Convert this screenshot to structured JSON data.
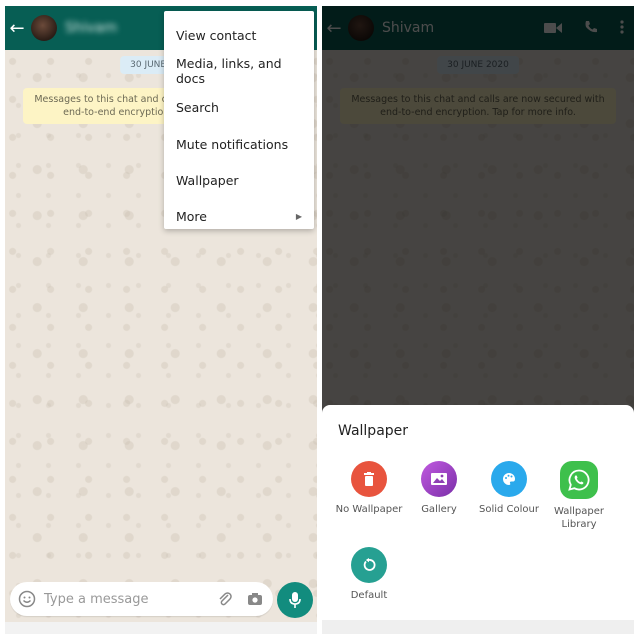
{
  "left": {
    "contact_name": "Shivam",
    "date_chip": "30 JUNE 2020",
    "secure_notice": "Messages to this chat and calls are now secured with end-to-end encryption. Tap for more info.",
    "menu": {
      "items": [
        {
          "label": "View contact"
        },
        {
          "label": "Media, links, and docs"
        },
        {
          "label": "Search"
        },
        {
          "label": "Mute notifications"
        },
        {
          "label": "Wallpaper"
        },
        {
          "label": "More",
          "submenu_icon": "arrow-right-icon"
        }
      ]
    },
    "input": {
      "placeholder": "Type a message"
    },
    "icons": [
      "back-arrow-icon",
      "emoji-icon",
      "attach-icon",
      "camera-icon",
      "mic-icon"
    ]
  },
  "right": {
    "contact_name": "Shivam",
    "date_chip": "30 JUNE 2020",
    "secure_notice": "Messages to this chat and calls are now secured with end-to-end encryption. Tap for more info.",
    "header_icons": [
      "video-call-icon",
      "voice-call-icon",
      "more-vert-icon"
    ],
    "sheet": {
      "title": "Wallpaper",
      "options": [
        {
          "label": "No Wallpaper",
          "color": "#e8543e",
          "icon": "trash-icon"
        },
        {
          "label": "Gallery",
          "color": "#8e3fb4",
          "icon": "image-icon"
        },
        {
          "label": "Solid Colour",
          "color": "#2aa9ec",
          "icon": "palette-icon"
        },
        {
          "label": "Wallpaper Library",
          "color": "#3ec04c",
          "icon": "whatsapp-icon"
        },
        {
          "label": "Default",
          "color": "#26a092",
          "icon": "reset-icon"
        }
      ]
    }
  }
}
